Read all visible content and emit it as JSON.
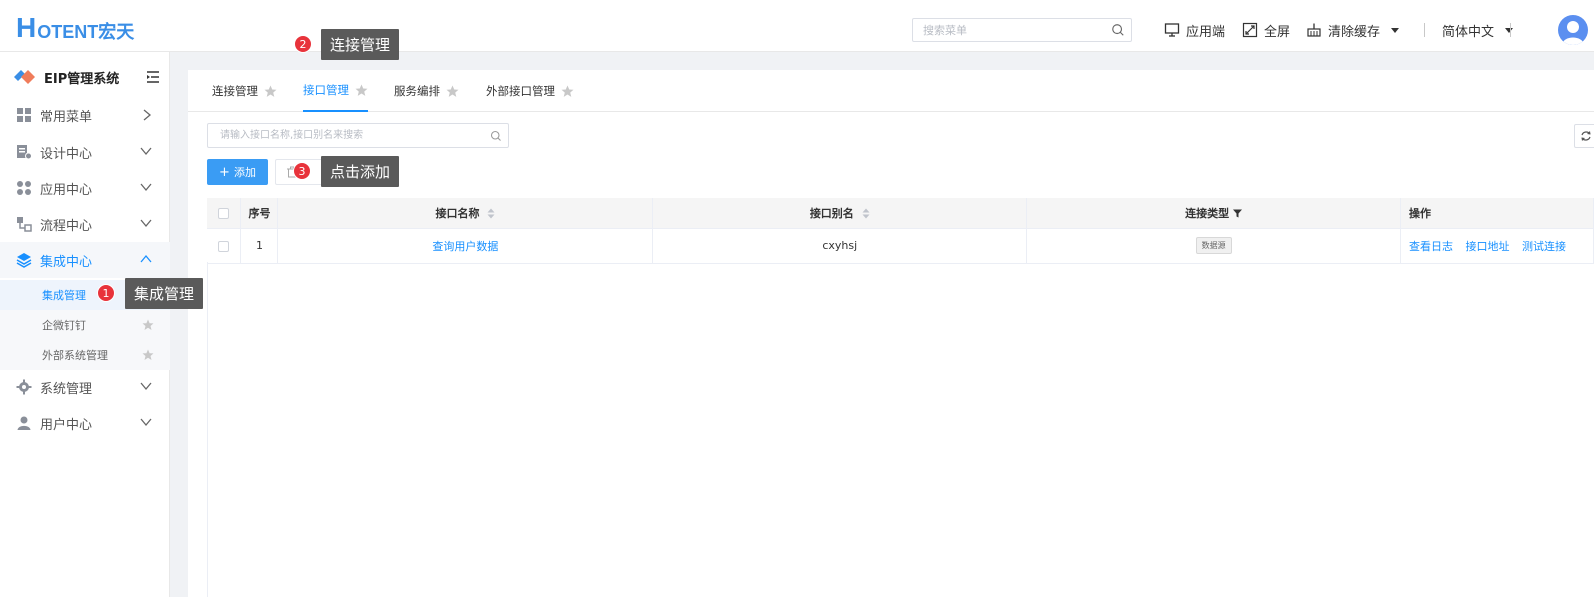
{
  "header": {
    "logo_h": "H",
    "logo_rest": "OTENT宏天",
    "search_placeholder": "搜索菜单",
    "app_end_label": "应用端",
    "fullscreen_label": "全屏",
    "clear_cache_label": "清除缓存",
    "language_label": "简体中文"
  },
  "sidebar": {
    "brand": "EIP管理系统",
    "menu": {
      "common": "常用菜单",
      "design": "设计中心",
      "apps": "应用中心",
      "process": "流程中心",
      "integration": "集成中心",
      "system": "系统管理",
      "user": "用户中心"
    },
    "submenu": {
      "integration_mgmt": "集成管理",
      "wecom": "企微钉钉",
      "external_system": "外部系统管理"
    }
  },
  "tabs": {
    "connection": "连接管理",
    "interface": "接口管理",
    "orchestration": "服务编排",
    "external_interface": "外部接口管理"
  },
  "toolbar": {
    "filter_placeholder": "请输入接口名称,接口别名来搜索",
    "add_label": "添加"
  },
  "table": {
    "headers": {
      "index": "序号",
      "name": "接口名称",
      "alias": "接口别名",
      "conn_type": "连接类型",
      "ops": "操作"
    },
    "rows": [
      {
        "index": "1",
        "name": "查询用户数据",
        "alias": "cxyhsj",
        "conn_type": "数据源",
        "op_log": "查看日志",
        "op_addr": "接口地址",
        "op_test": "测试连接"
      }
    ]
  },
  "callouts": {
    "c1": {
      "num": "1",
      "text": "集成管理"
    },
    "c2": {
      "num": "2",
      "text": "连接管理"
    },
    "c3": {
      "num": "3",
      "text": "点击添加"
    }
  },
  "colors": {
    "primary": "#1890ff",
    "add_button": "#3a9cf4",
    "callout_bg": "#5a5a5a",
    "badge": "#e8333b"
  }
}
